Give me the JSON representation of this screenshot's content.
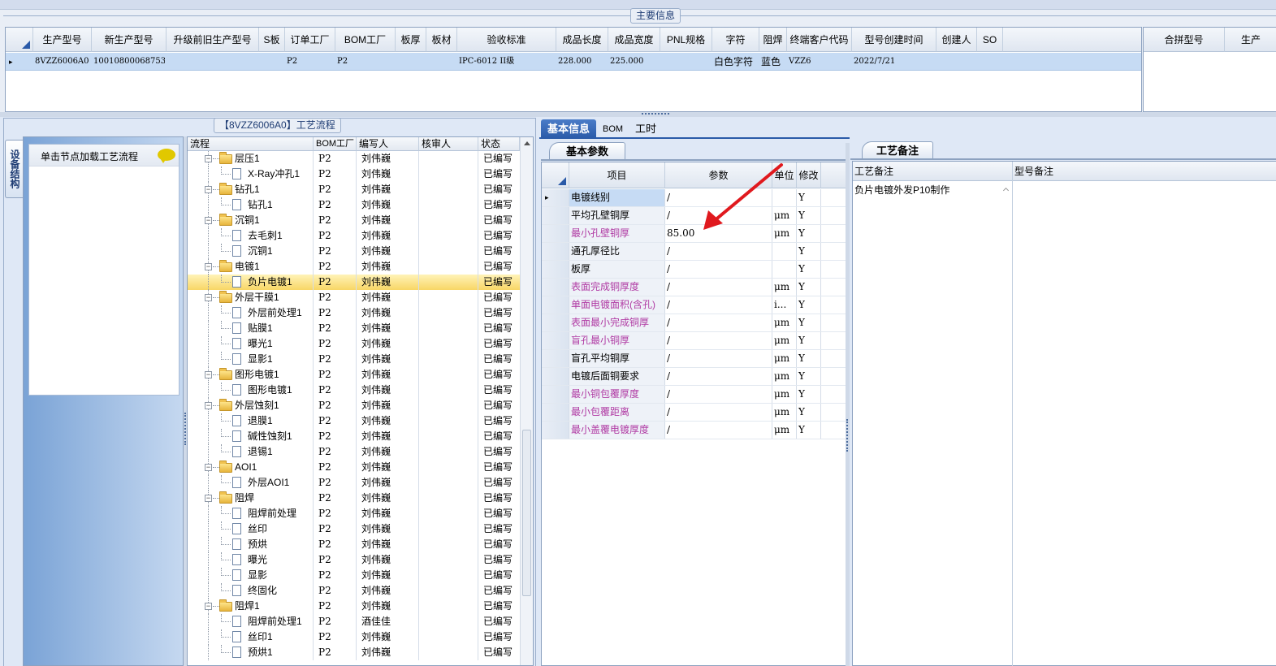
{
  "main_info": {
    "title": "主要信息",
    "columns": [
      "生产型号",
      "新生产型号",
      "升级前旧生产型号",
      "S板",
      "订单工厂",
      "BOM工厂",
      "板厚",
      "板材",
      "验收标准",
      "成品长度",
      "成品宽度",
      "PNL规格",
      "字符",
      "阻焊",
      "终端客户代码",
      "型号创建时间",
      "创建人",
      "SO"
    ],
    "row": {
      "生产型号": "8VZZ6006A0",
      "新生产型号": "10010800068753",
      "升级前旧生产型号": "",
      "S板": "",
      "订单工厂": "P2",
      "BOM工厂": "P2",
      "板厚": "",
      "板材": "",
      "验收标准": "IPC-6012 II级",
      "成品长度": "228.000",
      "成品宽度": "225.000",
      "PNL规格": "",
      "字符": "白色字符",
      "阻焊": "蓝色",
      "终端客户代码": "VZZ6",
      "型号创建时间": "2022/7/21",
      "创建人": "",
      "SO": ""
    },
    "merge_columns": [
      "合拼型号",
      "生产"
    ]
  },
  "process": {
    "title": "【8VZZ6006A0】工艺流程",
    "side_tab": "设备结构",
    "tree_hint": "单击节点加载工艺流程",
    "columns": [
      "流程",
      "BOM工厂",
      "编写人",
      "核审人",
      "状态"
    ],
    "rows": [
      {
        "name": "层压1",
        "level": 0,
        "factory": "P2",
        "writer": "刘伟巍",
        "status": "已编写"
      },
      {
        "name": "X-Ray冲孔1",
        "level": 1,
        "factory": "P2",
        "writer": "刘伟巍",
        "status": "已编写"
      },
      {
        "name": "钻孔1",
        "level": 0,
        "factory": "P2",
        "writer": "刘伟巍",
        "status": "已编写"
      },
      {
        "name": "钻孔1",
        "level": 1,
        "factory": "P2",
        "writer": "刘伟巍",
        "status": "已编写"
      },
      {
        "name": "沉铜1",
        "level": 0,
        "factory": "P2",
        "writer": "刘伟巍",
        "status": "已编写"
      },
      {
        "name": "去毛刺1",
        "level": 1,
        "factory": "P2",
        "writer": "刘伟巍",
        "status": "已编写"
      },
      {
        "name": "沉铜1",
        "level": 1,
        "factory": "P2",
        "writer": "刘伟巍",
        "status": "已编写"
      },
      {
        "name": "电镀1",
        "level": 0,
        "factory": "P2",
        "writer": "刘伟巍",
        "status": "已编写"
      },
      {
        "name": "负片电镀1",
        "level": 1,
        "factory": "P2",
        "writer": "刘伟巍",
        "status": "已编写",
        "selected": true
      },
      {
        "name": "外层干膜1",
        "level": 0,
        "factory": "P2",
        "writer": "刘伟巍",
        "status": "已编写"
      },
      {
        "name": "外层前处理1",
        "level": 1,
        "factory": "P2",
        "writer": "刘伟巍",
        "status": "已编写"
      },
      {
        "name": "贴膜1",
        "level": 1,
        "factory": "P2",
        "writer": "刘伟巍",
        "status": "已编写"
      },
      {
        "name": "曝光1",
        "level": 1,
        "factory": "P2",
        "writer": "刘伟巍",
        "status": "已编写"
      },
      {
        "name": "显影1",
        "level": 1,
        "factory": "P2",
        "writer": "刘伟巍",
        "status": "已编写"
      },
      {
        "name": "图形电镀1",
        "level": 0,
        "factory": "P2",
        "writer": "刘伟巍",
        "status": "已编写"
      },
      {
        "name": "图形电镀1",
        "level": 1,
        "factory": "P2",
        "writer": "刘伟巍",
        "status": "已编写"
      },
      {
        "name": "外层蚀刻1",
        "level": 0,
        "factory": "P2",
        "writer": "刘伟巍",
        "status": "已编写"
      },
      {
        "name": "退膜1",
        "level": 1,
        "factory": "P2",
        "writer": "刘伟巍",
        "status": "已编写"
      },
      {
        "name": "碱性蚀刻1",
        "level": 1,
        "factory": "P2",
        "writer": "刘伟巍",
        "status": "已编写"
      },
      {
        "name": "退锡1",
        "level": 1,
        "factory": "P2",
        "writer": "刘伟巍",
        "status": "已编写"
      },
      {
        "name": "AOI1",
        "level": 0,
        "factory": "P2",
        "writer": "刘伟巍",
        "status": "已编写"
      },
      {
        "name": "外层AOI1",
        "level": 1,
        "factory": "P2",
        "writer": "刘伟巍",
        "status": "已编写"
      },
      {
        "name": "阻焊",
        "level": 0,
        "factory": "P2",
        "writer": "刘伟巍",
        "status": "已编写"
      },
      {
        "name": "阻焊前处理",
        "level": 1,
        "factory": "P2",
        "writer": "刘伟巍",
        "status": "已编写"
      },
      {
        "name": "丝印",
        "level": 1,
        "factory": "P2",
        "writer": "刘伟巍",
        "status": "已编写"
      },
      {
        "name": "预烘",
        "level": 1,
        "factory": "P2",
        "writer": "刘伟巍",
        "status": "已编写"
      },
      {
        "name": "曝光",
        "level": 1,
        "factory": "P2",
        "writer": "刘伟巍",
        "status": "已编写"
      },
      {
        "name": "显影",
        "level": 1,
        "factory": "P2",
        "writer": "刘伟巍",
        "status": "已编写"
      },
      {
        "name": "终固化",
        "level": 1,
        "factory": "P2",
        "writer": "刘伟巍",
        "status": "已编写"
      },
      {
        "name": "阻焊1",
        "level": 0,
        "factory": "P2",
        "writer": "刘伟巍",
        "status": "已编写"
      },
      {
        "name": "阻焊前处理1",
        "level": 1,
        "factory": "P2",
        "writer": "酒佳佳",
        "status": "已编写"
      },
      {
        "name": "丝印1",
        "level": 1,
        "factory": "P2",
        "writer": "刘伟巍",
        "status": "已编写"
      },
      {
        "name": "预烘1",
        "level": 1,
        "factory": "P2",
        "writer": "刘伟巍",
        "status": "已编写"
      }
    ]
  },
  "basic_info": {
    "tabs": [
      "基本信息",
      "BOM",
      "工时"
    ],
    "subtab": "基本参数",
    "columns": [
      "项目",
      "参数",
      "单位",
      "修改"
    ],
    "rows": [
      {
        "item": "电镀线别",
        "value": "/",
        "unit": "",
        "mod": "Y",
        "pink": false,
        "current": true
      },
      {
        "item": "平均孔壁铜厚",
        "value": "/",
        "unit": "μm",
        "mod": "Y",
        "pink": false
      },
      {
        "item": "最小孔壁铜厚",
        "value": "85.00",
        "unit": "μm",
        "mod": "Y",
        "pink": true
      },
      {
        "item": "通孔厚径比",
        "value": "/",
        "unit": "",
        "mod": "Y",
        "pink": false
      },
      {
        "item": "板厚",
        "value": "/",
        "unit": "",
        "mod": "Y",
        "pink": false
      },
      {
        "item": "表面完成铜厚度",
        "value": "/",
        "unit": "μm",
        "mod": "Y",
        "pink": true
      },
      {
        "item": "单面电镀面积(含孔)",
        "value": "/",
        "unit": "i...",
        "mod": "Y",
        "pink": true
      },
      {
        "item": "表面最小完成铜厚",
        "value": "/",
        "unit": "μm",
        "mod": "Y",
        "pink": true
      },
      {
        "item": "盲孔最小铜厚",
        "value": "/",
        "unit": "μm",
        "mod": "Y",
        "pink": true
      },
      {
        "item": "盲孔平均铜厚",
        "value": "/",
        "unit": "μm",
        "mod": "Y",
        "pink": false
      },
      {
        "item": "电镀后面铜要求",
        "value": "/",
        "unit": "μm",
        "mod": "Y",
        "pink": false
      },
      {
        "item": "最小铜包覆厚度",
        "value": "/",
        "unit": "μm",
        "mod": "Y",
        "pink": true
      },
      {
        "item": "最小包覆距离",
        "value": "/",
        "unit": "μm",
        "mod": "Y",
        "pink": true
      },
      {
        "item": "最小盖覆电镀厚度",
        "value": "/",
        "unit": "μm",
        "mod": "Y",
        "pink": true
      }
    ]
  },
  "remarks": {
    "subtab": "工艺备注",
    "columns": [
      "工艺备注",
      "型号备注"
    ],
    "process_remark": "负片电镀外发P10制作",
    "model_remark": ""
  },
  "colors": {
    "accent": "#2a5aa8",
    "selection": "#c6dbf4",
    "tree_selection": "#f8d666",
    "pink_label": "#b03aa3",
    "annotation_arrow": "#e0191e"
  }
}
